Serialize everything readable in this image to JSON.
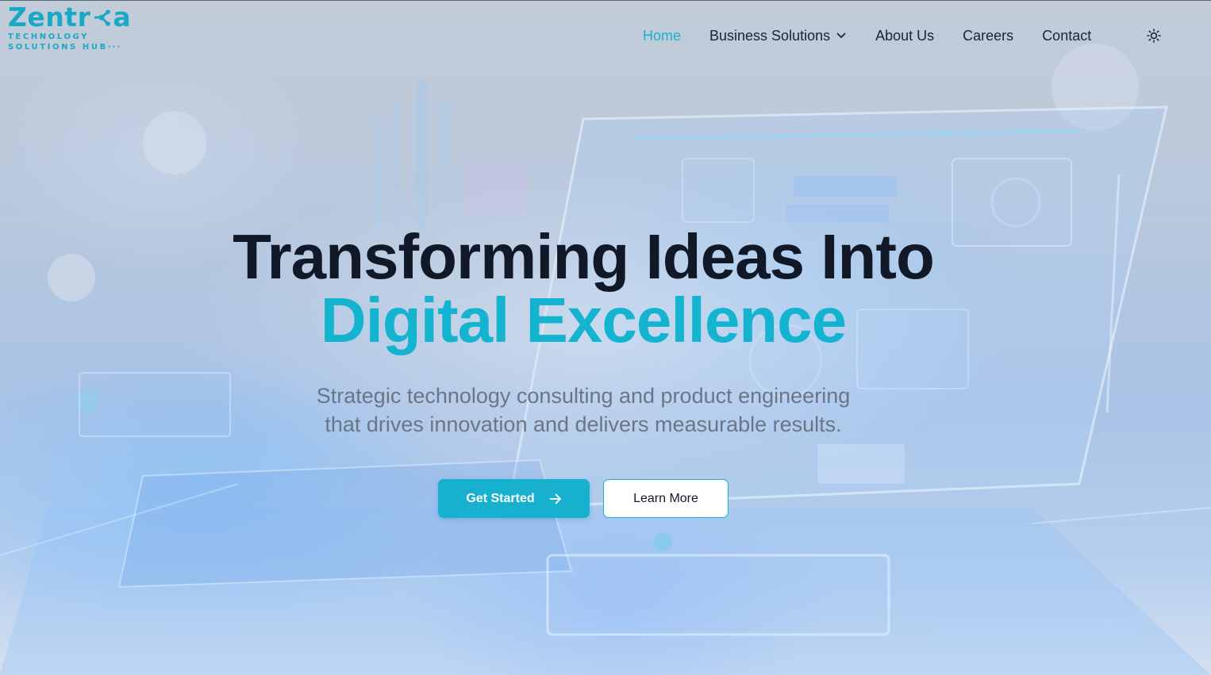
{
  "brand": {
    "name": "Zentra",
    "name_start": "Zentr",
    "name_end": "a",
    "tagline_line1": "TECHNOLOGY",
    "tagline_line2": "SOLUTIONS HUB",
    "tagline_dots": "···",
    "accent_color": "#16a9c8"
  },
  "nav": {
    "items": [
      {
        "label": "Home",
        "active": true
      },
      {
        "label": "Business Solutions",
        "has_dropdown": true
      },
      {
        "label": "About Us"
      },
      {
        "label": "Careers"
      },
      {
        "label": "Contact"
      }
    ],
    "theme_toggle_icon": "sun-icon"
  },
  "hero": {
    "title_line1": "Transforming Ideas Into",
    "title_line2": "Digital Excellence",
    "subtitle_line1": "Strategic technology consulting and product engineering",
    "subtitle_line2": "that drives innovation and delivers measurable results.",
    "primary_button": "Get Started",
    "secondary_button": "Learn More",
    "primary_icon": "arrow-right-icon"
  },
  "colors": {
    "accent": "#17b1cf",
    "heading": "#111827",
    "body_text": "#6b7587"
  }
}
